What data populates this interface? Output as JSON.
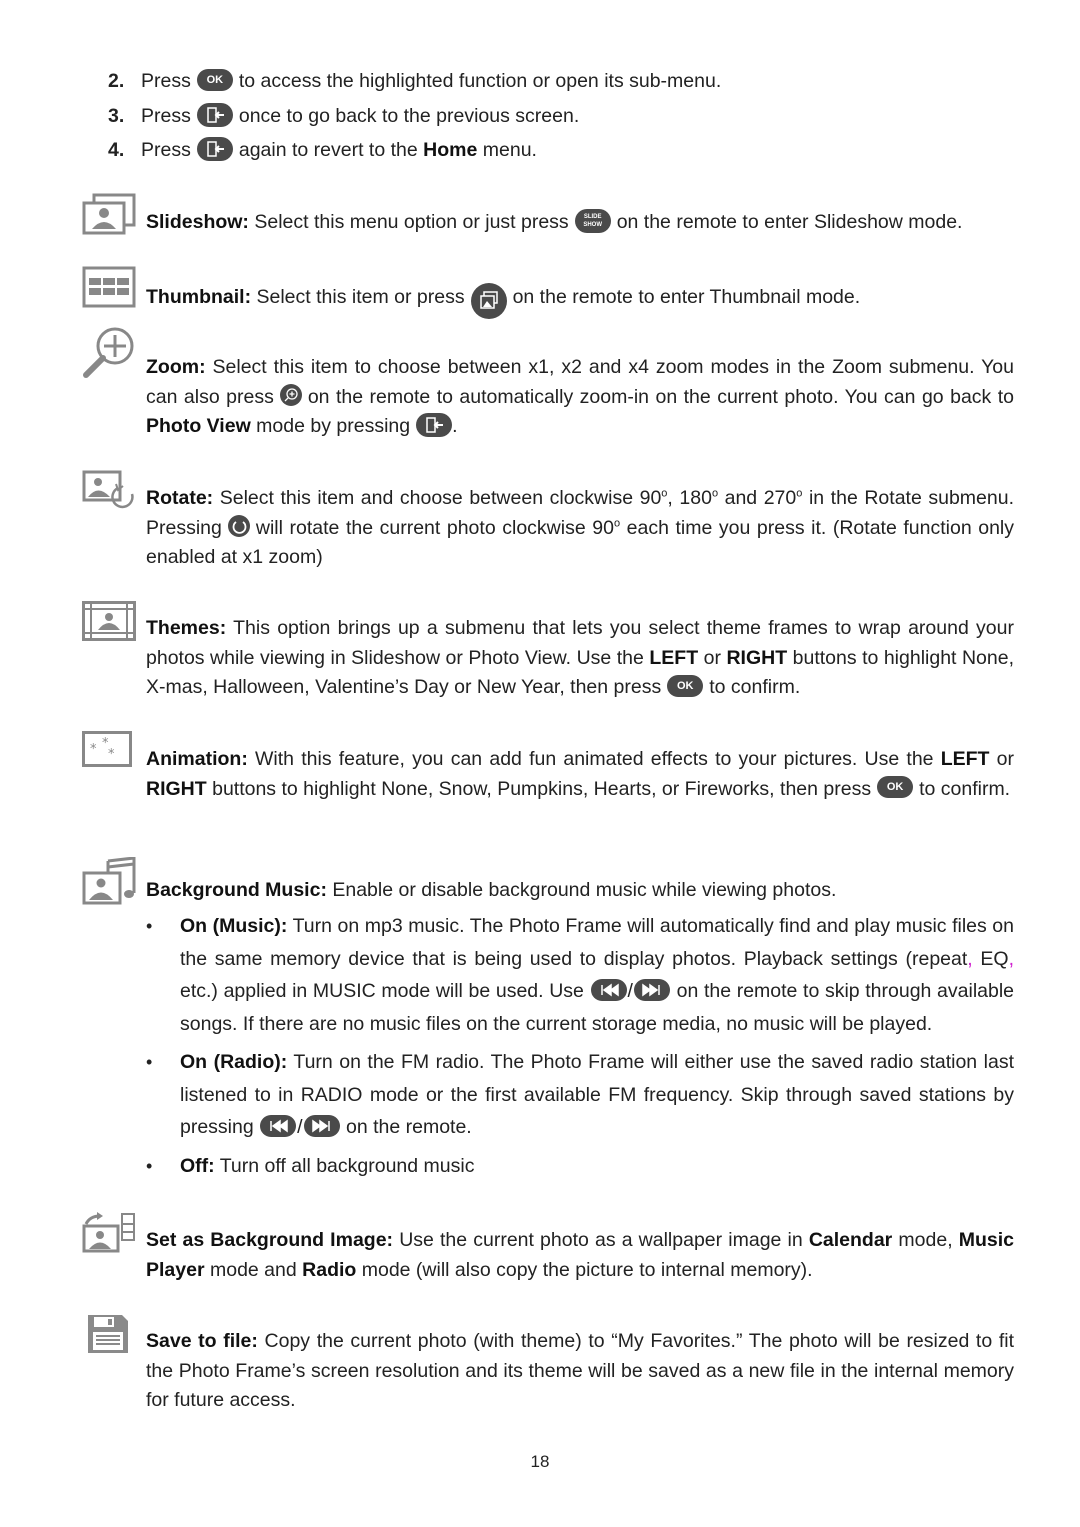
{
  "steps": [
    {
      "num": "2.",
      "pre": "Press",
      "key": "OK",
      "post": "to access the highlighted function or open its sub-menu."
    },
    {
      "num": "3.",
      "pre": "Press",
      "key": "back",
      "post": "once to go back to the previous screen."
    },
    {
      "num": "4.",
      "pre": "Press",
      "key": "back",
      "post_a": "again to revert to the",
      "post_bold": "Home",
      "post_b": "menu."
    }
  ],
  "keys": {
    "ok_label": "OK",
    "slideshow_line1": "SLIDE",
    "slideshow_line2": "SHOW"
  },
  "items": {
    "slideshow": {
      "title": "Slideshow:",
      "a": "Select this menu option or just press",
      "b": "on the remote to enter Slideshow mode."
    },
    "thumbnail": {
      "title": "Thumbnail:",
      "a": "Select this item or press",
      "b": "on the remote to enter Thumbnail mode."
    },
    "zoom": {
      "title": "Zoom:",
      "a": "Select this item to choose between x1, x2 and x4 zoom modes in the Zoom submenu. You can also press",
      "b": "on the remote to automatically zoom-in on the current photo. You can go back to",
      "bold": "Photo View",
      "c": "mode by pressing",
      "d": "."
    },
    "rotate": {
      "title": "Rotate:",
      "a": "Select this item and choose between clockwise 90",
      "deg": "o",
      "b": ", 180",
      "c": " and 270",
      "d": " in the Rotate submenu. Pressing",
      "e": "will rotate the current photo clockwise 90",
      "f": " each time you press it. (Rotate function only enabled at x1 zoom)"
    },
    "themes": {
      "title": "Themes:",
      "a": "This option brings up a submenu that lets you select theme frames to wrap around your photos while viewing in Slideshow or Photo View. Use the",
      "left": "LEFT",
      "or": "or",
      "right": "RIGHT",
      "b": "buttons to highlight None, X-mas, Halloween, Valentine’s Day or New Year, then press",
      "c": "to confirm."
    },
    "animation": {
      "title": "Animation:",
      "a": "With this feature, you can add fun animated effects to your pictures. Use the",
      "left": "LEFT",
      "or": "or",
      "right": "RIGHT",
      "b": "buttons to highlight None, Snow, Pumpkins, Hearts, or Fireworks, then press",
      "c": "to confirm."
    },
    "music": {
      "title": "Background Music:",
      "a": "Enable or disable background music while viewing photos.",
      "bullets": [
        {
          "title": "On (Music):",
          "a": "Turn on mp3 music. The Photo Frame will automatically find and play music files on the same memory device that is being used to display photos. Playback settings (repeat",
          "comma": ",",
          "b": " EQ",
          "c": " etc.) applied in MUSIC mode will be used. Use",
          "slash": "/",
          "d": "on the remote to skip through available songs. If there are no music files on the current storage media, no music will be played."
        },
        {
          "title": "On (Radio):",
          "a": "Turn on the FM radio. The Photo Frame will either use the saved radio station last listened to in RADIO mode or the first available FM frequency. Skip through saved stations by pressing",
          "slash": "/",
          "b": "on the remote."
        },
        {
          "title": "Off:",
          "a": "Turn off all background music"
        }
      ]
    },
    "background": {
      "title": "Set as Background Image:",
      "a": "Use the current photo as a wallpaper image in",
      "b1": "Calendar",
      "b": "mode,",
      "b2": "Music Player",
      "c": "mode and",
      "b3": "Radio",
      "d": "mode (will also copy the picture to internal memory)."
    },
    "save": {
      "title": "Save to file:",
      "a": "Copy the current photo (with theme) to “My Favorites.” The photo will be resized to fit the Photo Frame’s screen resolution and its theme will be saved as a new file in the internal memory for future access."
    }
  },
  "bullet_char": "•",
  "page_number": "18"
}
